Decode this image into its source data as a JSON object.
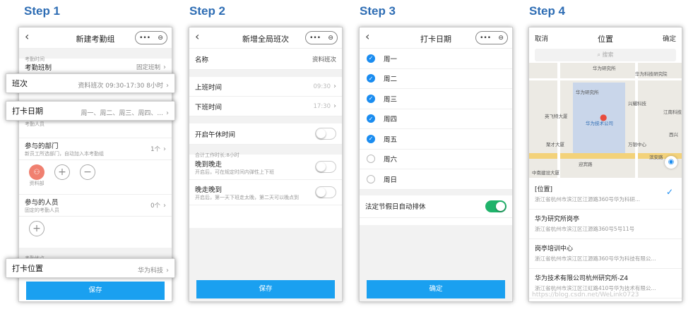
{
  "steps": [
    "Step 1",
    "Step 2",
    "Step 3",
    "Step 4"
  ],
  "p1": {
    "title": "新建考勤组",
    "section1": "考勤时间",
    "shift_label": "考勤班制",
    "shift_value": "固定班制",
    "callout_shift_label": "班次",
    "callout_shift_value": "资料班次 09:30-17:30 8小时",
    "callout_days_label": "打卡日期",
    "callout_days_value": "周一、周二、周三、周四、...",
    "section2": "考勤人员",
    "dept_label": "参与的部门",
    "dept_hint": "新员工所选部门，自动加入本考勤组",
    "dept_count": "1个",
    "dept_name": "资料部",
    "people_label": "参与的人员",
    "people_hint": "固定的考勤人员",
    "people_count": "0个",
    "section3": "考勤地点",
    "callout_loc_label": "打卡位置",
    "callout_loc_value": "华为科技",
    "save": "保存"
  },
  "p2": {
    "title": "新增全局班次",
    "name_label": "名称",
    "name_value": "资料班次",
    "in_label": "上班时间",
    "in_value": "09:30",
    "out_label": "下班时间",
    "out_value": "17:30",
    "lunch_label": "开启午休时间",
    "total": "合计工作时长:8小时",
    "late_label": "晚到晚走",
    "late_hint": "开启后，可在规定时间内弹性上下班",
    "early_label": "晚走晚到",
    "early_hint": "开启后，第一天下班走太晚，第二天可以晚点到",
    "save": "保存"
  },
  "p3": {
    "title": "打卡日期",
    "days": [
      {
        "label": "周一",
        "on": true
      },
      {
        "label": "周二",
        "on": true
      },
      {
        "label": "周三",
        "on": true
      },
      {
        "label": "周四",
        "on": true
      },
      {
        "label": "周五",
        "on": true
      },
      {
        "label": "周六",
        "on": false
      },
      {
        "label": "周日",
        "on": false
      }
    ],
    "holiday_label": "法定节假日自动排休",
    "confirm": "确定"
  },
  "p4": {
    "cancel": "取消",
    "title": "位置",
    "confirm": "确定",
    "search": "搜索",
    "map_labels": [
      "华为研究所",
      "华为科技研究院",
      "华为研究所",
      "迎宾路",
      "英飞特大厦",
      "聚才大厦",
      "万银中心",
      "兴耀科技",
      "中南建设大厦",
      "滨安路",
      "江南科技",
      "西兴"
    ],
    "map_marker": "华为技术公司",
    "items": [
      {
        "name": "[位置]",
        "addr": "浙江省杭州市滨江区江源路360号华为科研..."
      },
      {
        "name": "华为研究所岗亭",
        "addr": "浙江省杭州市滨江区江源路360号5号11号"
      },
      {
        "name": "岗亭培训中心",
        "addr": "浙江省杭州市滨江区江源路360号华为科技有限公..."
      },
      {
        "name": "华为技术有限公司杭州研究所-Z4",
        "addr": "浙江省杭州市滨江区江虹路410号华为技术有限公..."
      }
    ],
    "watermark": "https://blog.csdn.net/WeLink0723"
  },
  "colors": {
    "accent": "#1aa0f0",
    "step": "#2e6db4",
    "green": "#20b36b",
    "check": "#1a8cf0"
  }
}
